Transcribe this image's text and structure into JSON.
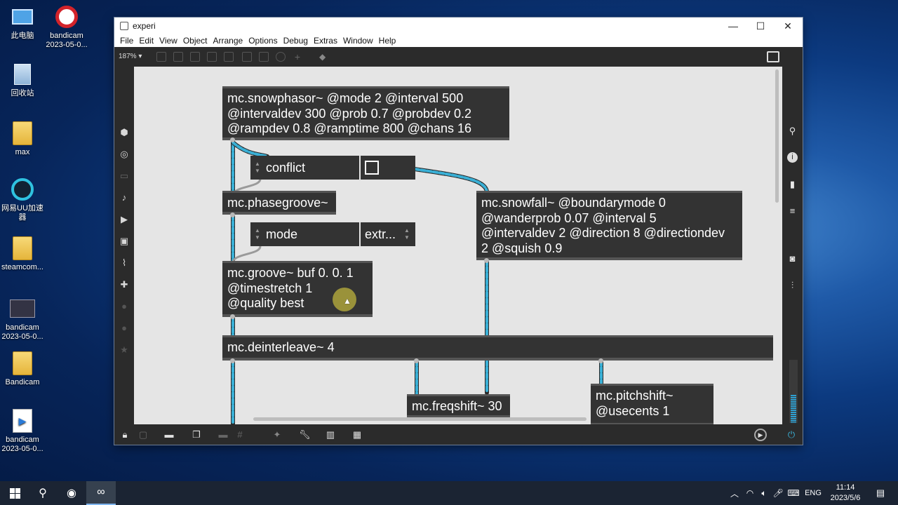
{
  "desktop": {
    "icons": [
      {
        "label": "此电脑",
        "icon": "computer-icon"
      },
      {
        "label": "bandicam\n2023-05-0...",
        "icon": "bandicam-icon"
      },
      {
        "label": "回收站",
        "icon": "recycle-bin-icon"
      },
      {
        "label": "max",
        "icon": "folder-icon"
      },
      {
        "label": "网易UU加速\n器",
        "icon": "uu-accelerator-icon"
      },
      {
        "label": "steamcom...",
        "icon": "folder-icon"
      },
      {
        "label": "bandicam\n2023-05-0...",
        "icon": "video-file-icon"
      },
      {
        "label": "Bandicam",
        "icon": "folder-icon"
      },
      {
        "label": "bandicam\n2023-05-0...",
        "icon": "video-file-icon"
      }
    ]
  },
  "window": {
    "title": "experi",
    "controls": {
      "minimize": "—",
      "maximize": "☐",
      "close": "✕"
    }
  },
  "menu": [
    "File",
    "Edit",
    "View",
    "Object",
    "Arrange",
    "Options",
    "Debug",
    "Extras",
    "Window",
    "Help"
  ],
  "toolbar": {
    "zoom": "187% ▾"
  },
  "patch": {
    "snowphasor": "mc.snowphasor~ @mode 2 @interval 500\n@intervaldev 300 @prob 0.7 @probdev 0.2\n@rampdev 0.8 @ramptime 800 @chans 16",
    "conflict_menu": "conflict",
    "phasegroove": "mc.phasegroove~",
    "mode_menu": "mode",
    "extr_menu": "extr...",
    "groove": "mc.groove~ buf 0. 0. 1\n@timestretch 1\n@quality best",
    "snowfall": "mc.snowfall~ @boundarymode 0\n@wanderprob 0.07 @interval 5\n@intervaldev 2 @direction 8 @directiondev\n2 @squish 0.9",
    "deinterleave": "mc.deinterleave~ 4",
    "freqshift": "mc.freqshift~ 30",
    "pitchshift": "mc.pitchshift~\n@usecents 1"
  },
  "colors": {
    "patchcord": "#3ab0d6",
    "object_bg": "#333333",
    "canvas": "#e5e5e5"
  },
  "taskbar": {
    "lang": "ENG",
    "time": "11:14",
    "date": "2023/5/6"
  }
}
